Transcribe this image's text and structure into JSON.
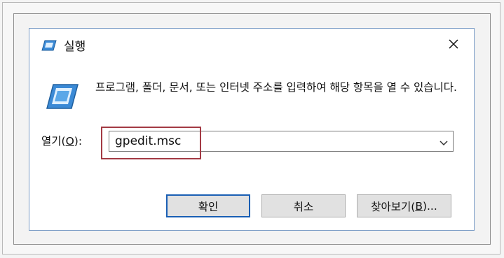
{
  "dialog": {
    "title": "실행",
    "title_icon": "run-icon",
    "close_icon": "close-icon",
    "description": "프로그램, 폴더, 문서, 또는 인터넷 주소를 입력하여 해당 항목을 열 수 있습니다.",
    "open_label_prefix": "열기(",
    "open_label_mnemonic": "O",
    "open_label_suffix": "):",
    "open_value": "gpedit.msc",
    "buttons": {
      "ok": "확인",
      "cancel": "취소",
      "browse_prefix": "찾아보기(",
      "browse_mnemonic": "B",
      "browse_suffix": ")..."
    }
  },
  "colors": {
    "highlight_box": "#a33a44",
    "dialog_border": "#7a9cc6",
    "default_button_border": "#1a5fb4"
  }
}
